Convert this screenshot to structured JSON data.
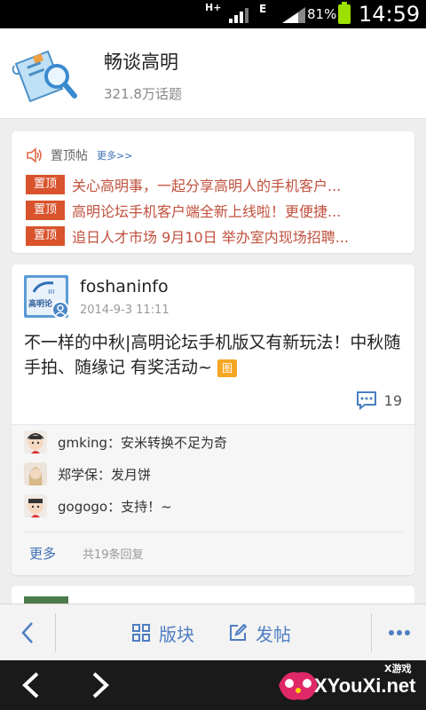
{
  "status_bar": {
    "network": "H+",
    "network2": "E",
    "battery_percent": "81%",
    "time": "14:59"
  },
  "forum": {
    "title": "畅谈高明",
    "topic_count": "321.8万话题",
    "logo_icon": "scroll-magnifier-icon"
  },
  "pinned": {
    "label": "置顶帖",
    "more": "更多>>",
    "tag": "置顶",
    "items": [
      "关心高明事，一起分享高明人的手机客户...",
      "高明论坛手机客户端全新上线啦！更便捷...",
      "追日人才市场 9月10日 举办室内现场招聘..."
    ]
  },
  "post": {
    "author": "foshaninfo",
    "date": "2014-9-3 11:11",
    "avatar_text": "高明论",
    "title": "不一样的中秋|高明论坛手机版又有新玩法！中秋随手拍、随缘记 有奖活动~",
    "image_tag": "图",
    "comment_count": "19",
    "replies": [
      {
        "text": "gmking：安米转换不足为奇"
      },
      {
        "text": "郑学保：发月饼"
      },
      {
        "text": "gogogo：支持！~"
      }
    ],
    "more_label": "更多",
    "reply_total": "共19条回复"
  },
  "toolbar": {
    "sections_label": "版块",
    "post_label": "发帖"
  },
  "watermark": {
    "small": "X游戏",
    "big": "XYouXi.net"
  },
  "colors": {
    "accent_blue": "#4f7ec2",
    "pinned_red": "#d9532c",
    "tag_orange": "#f5a623"
  }
}
